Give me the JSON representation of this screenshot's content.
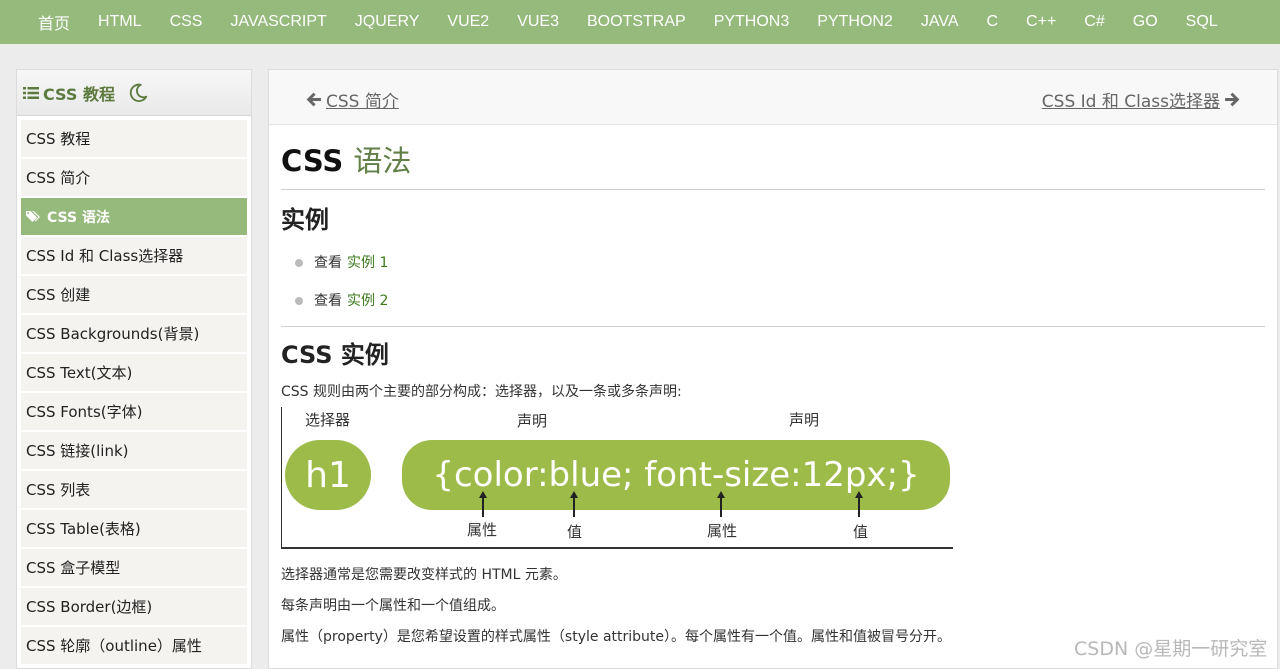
{
  "nav": {
    "items": [
      "首页",
      "HTML",
      "CSS",
      "JAVASCRIPT",
      "JQUERY",
      "VUE2",
      "VUE3",
      "BOOTSTRAP",
      "PYTHON3",
      "PYTHON2",
      "JAVA",
      "C",
      "C++",
      "C#",
      "GO",
      "SQL"
    ]
  },
  "sidebar": {
    "title": "CSS 教程",
    "items": [
      {
        "label": "CSS 教程",
        "active": false
      },
      {
        "label": "CSS 简介",
        "active": false
      },
      {
        "label": "CSS 语法",
        "active": true
      },
      {
        "label": "CSS Id 和 Class选择器",
        "active": false
      },
      {
        "label": "CSS 创建",
        "active": false
      },
      {
        "label": "CSS Backgrounds(背景)",
        "active": false
      },
      {
        "label": "CSS Text(文本)",
        "active": false
      },
      {
        "label": "CSS Fonts(字体)",
        "active": false
      },
      {
        "label": "CSS 链接(link)",
        "active": false
      },
      {
        "label": "CSS 列表",
        "active": false
      },
      {
        "label": "CSS Table(表格)",
        "active": false
      },
      {
        "label": "CSS 盒子模型",
        "active": false
      },
      {
        "label": "CSS Border(边框)",
        "active": false
      },
      {
        "label": "CSS 轮廓（outline）属性",
        "active": false
      }
    ]
  },
  "pager": {
    "prev": "CSS 简介",
    "next": "CSS Id 和 Class选择器"
  },
  "main": {
    "title_prefix": "CSS",
    "title_accent": "语法",
    "examples_heading": "实例",
    "examples": [
      {
        "prefix": "查看",
        "link": "实例 1"
      },
      {
        "prefix": "查看",
        "link": "实例 2"
      }
    ],
    "css_example_heading": "CSS 实例",
    "intro": "CSS 规则由两个主要的部分构成：选择器，以及一条或多条声明:",
    "diagram": {
      "selector_label": "选择器",
      "declaration_label_1": "声明",
      "declaration_label_2": "声明",
      "selector": "h1",
      "declaration": "{color:blue; font-size:12px;}",
      "property_label_1": "属性",
      "value_label_1": "值",
      "property_label_2": "属性",
      "value_label_2": "值"
    },
    "p1": "选择器通常是您需要改变样式的 HTML 元素。",
    "p2": "每条声明由一个属性和一个值组成。",
    "p3": "属性（property）是您希望设置的样式属性（style attribute）。每个属性有一个值。属性和值被冒号分开。"
  },
  "watermark": "CSDN @星期一研究室",
  "colors": {
    "nav_bg": "#96b97c",
    "accent_green": "#617f47",
    "link_green": "#3d7a1e",
    "diagram_green": "#9dbb49"
  }
}
